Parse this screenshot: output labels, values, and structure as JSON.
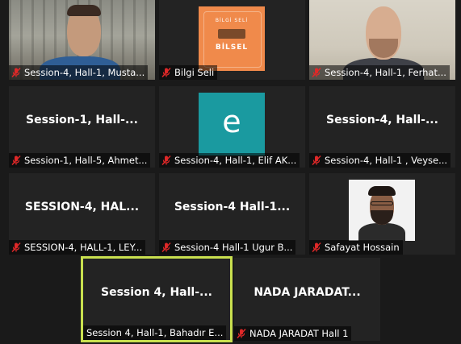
{
  "tiles": [
    {
      "label": "Session-4, Hall-1, Musta..."
    },
    {
      "label": "Bilgi Seli",
      "logo_text": "BİLSEL",
      "logo_sub": "BİLGİ SELİ"
    },
    {
      "label": "Session-4, Hall-1, Ferhat..."
    },
    {
      "label": "Session-1, Hall-5, Ahmet...",
      "display": "Session-1,  Hall-..."
    },
    {
      "label": "Session-4, Hall-1, Elif AK...",
      "avatar_letter": "e"
    },
    {
      "label": "Session-4, Hall-1 , Veyse...",
      "display": "Session-4,  Hall-..."
    },
    {
      "label": "SESSION-4, HALL-1, LEY...",
      "display": "SESSION-4,  HAL..."
    },
    {
      "label": "Session-4 Hall-1 Ugur B...",
      "display": "Session-4  Hall-1..."
    },
    {
      "label": "Safayat Hossain"
    },
    {
      "label": "Session 4, Hall-1, Bahadır E...",
      "display": "Session  4,  Hall-..."
    },
    {
      "label": "NADA JARADAT Hall 1",
      "display": "NADA JARADAT..."
    }
  ],
  "colors": {
    "background": "#1a1a1a",
    "tile": "#232323",
    "active_border": "#c9e04f",
    "muted_mic": "#e02828",
    "logo_orange": "#f08a4b",
    "avatar_teal": "#1a9aa0"
  },
  "icons": {
    "mic": "muted-microphone-icon"
  }
}
